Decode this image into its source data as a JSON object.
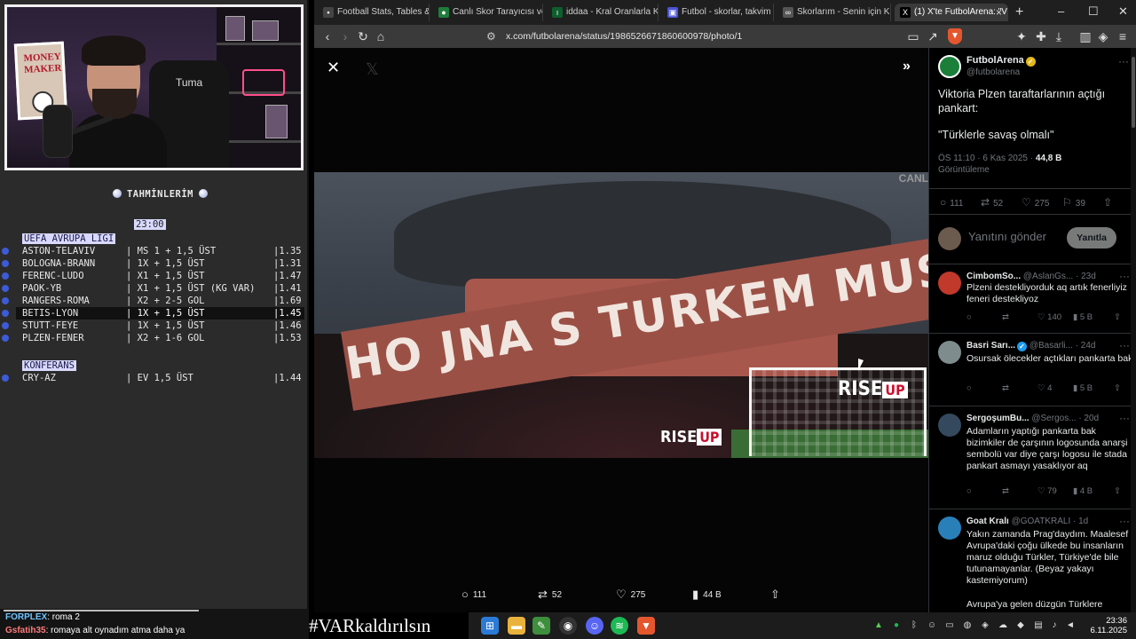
{
  "stream": {
    "webcam": {
      "poster_text": "MONEY MAKER",
      "chair_label": "Tuma"
    },
    "tipster": {
      "title": "TAHMİNLERİM",
      "time": "23:00",
      "leagues": [
        {
          "name": "UEFA AVRUPA LİGİ",
          "rows": [
            {
              "match": "ASTON-TELAVIV",
              "bet": "| MS 1 + 1,5 ÜST",
              "odd": "|1.35",
              "selected": false,
              "dot": true
            },
            {
              "match": "BOLOGNA-BRANN",
              "bet": "| 1X + 1,5 ÜST",
              "odd": "|1.31",
              "selected": false,
              "dot": true
            },
            {
              "match": "FERENC-LUDO",
              "bet": "| X1 + 1,5 ÜST",
              "odd": "|1.47",
              "selected": false,
              "dot": true
            },
            {
              "match": "PAOK-YB",
              "bet": "| X1 + 1,5 ÜST (KG VAR)",
              "odd": "|1.41",
              "selected": false,
              "dot": true
            },
            {
              "match": "RANGERS-ROMA",
              "bet": "| X2 + 2-5 GOL",
              "odd": "|1.69",
              "selected": false,
              "dot": true
            },
            {
              "match": "BETIS-LYON",
              "bet": "| 1X + 1,5 ÜST",
              "odd": "|1.45",
              "selected": true,
              "dot": true
            },
            {
              "match": "STUTT-FEYE",
              "bet": "| 1X + 1,5 ÜST",
              "odd": "|1.46",
              "selected": false,
              "dot": true
            },
            {
              "match": "PLZEN-FENER",
              "bet": "| X2 + 1-6 GOL",
              "odd": "|1.53",
              "selected": false,
              "dot": true
            }
          ]
        },
        {
          "name": "KONFERANS",
          "rows": [
            {
              "match": "CRY-AZ",
              "bet": "| EV 1,5 ÜST",
              "odd": "|1.44",
              "selected": false,
              "dot": true
            }
          ]
        }
      ]
    },
    "chat": [
      {
        "user": "FORPLEX",
        "message": ": roma 2"
      },
      {
        "user": "Gsfatih35",
        "message": ": romaya alt oynadım atma daha ya"
      }
    ]
  },
  "browser": {
    "tabs": [
      {
        "label": "Football Stats, Tables & Dat",
        "icon": "stats-icon",
        "color": "#2b2b2b",
        "active": false
      },
      {
        "label": "Canlı Skor Tarayıcısı ve Canl",
        "icon": "score-icon",
        "color": "#2b2b2b",
        "active": false
      },
      {
        "label": "iddaa - Kral Oranlarla Kralla",
        "icon": "iddaa-icon",
        "color": "#2b2b2b",
        "active": false
      },
      {
        "label": "Futbol - skorlar, takvim & n",
        "icon": "flashscore-icon",
        "color": "#2b2b2b",
        "active": false
      },
      {
        "label": "Skorlarım - Senin için Kişise",
        "icon": "mackolik-icon",
        "color": "#2b2b2b",
        "active": false
      },
      {
        "label": "(1) X'te FutbolArena: \"V",
        "icon": "x-icon",
        "color": "#3a3a3a",
        "active": true
      }
    ],
    "url": "x.com/futbolarena/status/1986526671860600978/photo/1"
  },
  "photo": {
    "banner_text": "HO JNA S TURKEM MUSIME JIT!",
    "sponsor": "RISE",
    "sponsor_up": "UP",
    "corner_text": "CANL"
  },
  "photo_actions": {
    "replies": "111",
    "reposts": "52",
    "likes": "275",
    "views": "44 B"
  },
  "tweet": {
    "author_name": "FutbolArena",
    "author_handle": "@futbolarena",
    "text_line1": "Viktoria Plzen taraftarlarının açtığı pankart:",
    "text_line2": "\"Türklerle savaş olmalı\"",
    "time": "ÖS 11:10 · 6 Kas 2025 ·",
    "views_count": "44,8 B",
    "views_label": "Görüntüleme",
    "stats": {
      "replies": "111",
      "reposts": "52",
      "likes": "275",
      "bookmarks": "39"
    },
    "reply_placeholder": "Yanıtını gönder",
    "reply_button": "Yanıtla"
  },
  "comments": [
    {
      "name": "CimbomSo...",
      "handle": "@AslanGs...",
      "age": "· 23d",
      "verified": false,
      "text": "Plzeni destekliyorduk aq artık fenerliyiz feneri destekliyoz",
      "likes": "140",
      "views": "5 B",
      "avatar_color": "#c0392b"
    },
    {
      "name": "Basri Sarı...",
      "handle": "@Basarli...",
      "age": "· 24d",
      "verified": true,
      "text": "Osursak ölecekler açtıkları pankarta bak",
      "likes": "4",
      "views": "5 B",
      "avatar_color": "#7f8c8d"
    },
    {
      "name": "SergoşumBu...",
      "handle": "@Sergos...",
      "age": "· 20d",
      "verified": false,
      "text": "Adamların yaptığı pankarta bak bizimkiler de çarşının logosunda anarşi sembolü var diye çarşı logosu ile stada pankart asmayı yasaklıyor aq",
      "likes": "79",
      "views": "4 B",
      "avatar_color": "#34495e"
    },
    {
      "name": "Goat Kralı",
      "handle": "@GOATKRALI",
      "age": "· 1d",
      "verified": false,
      "text": "Yakın zamanda Prag'daydım. Maalesef Avrupa'daki çoğu ülkede bu insanların maruz olduğu Türkler, Türkiye'de bile tutunamayanlar. (Beyaz yakayı kastemiyorum)",
      "text2": "Avrupa'ya gelen düzgün Türklere",
      "likes": "",
      "views": "",
      "avatar_color": "#2980b9"
    }
  ],
  "taskbar": {
    "hashtag": "#VARkaldırılsın",
    "time": "23:36",
    "date": "6.11.2025"
  }
}
